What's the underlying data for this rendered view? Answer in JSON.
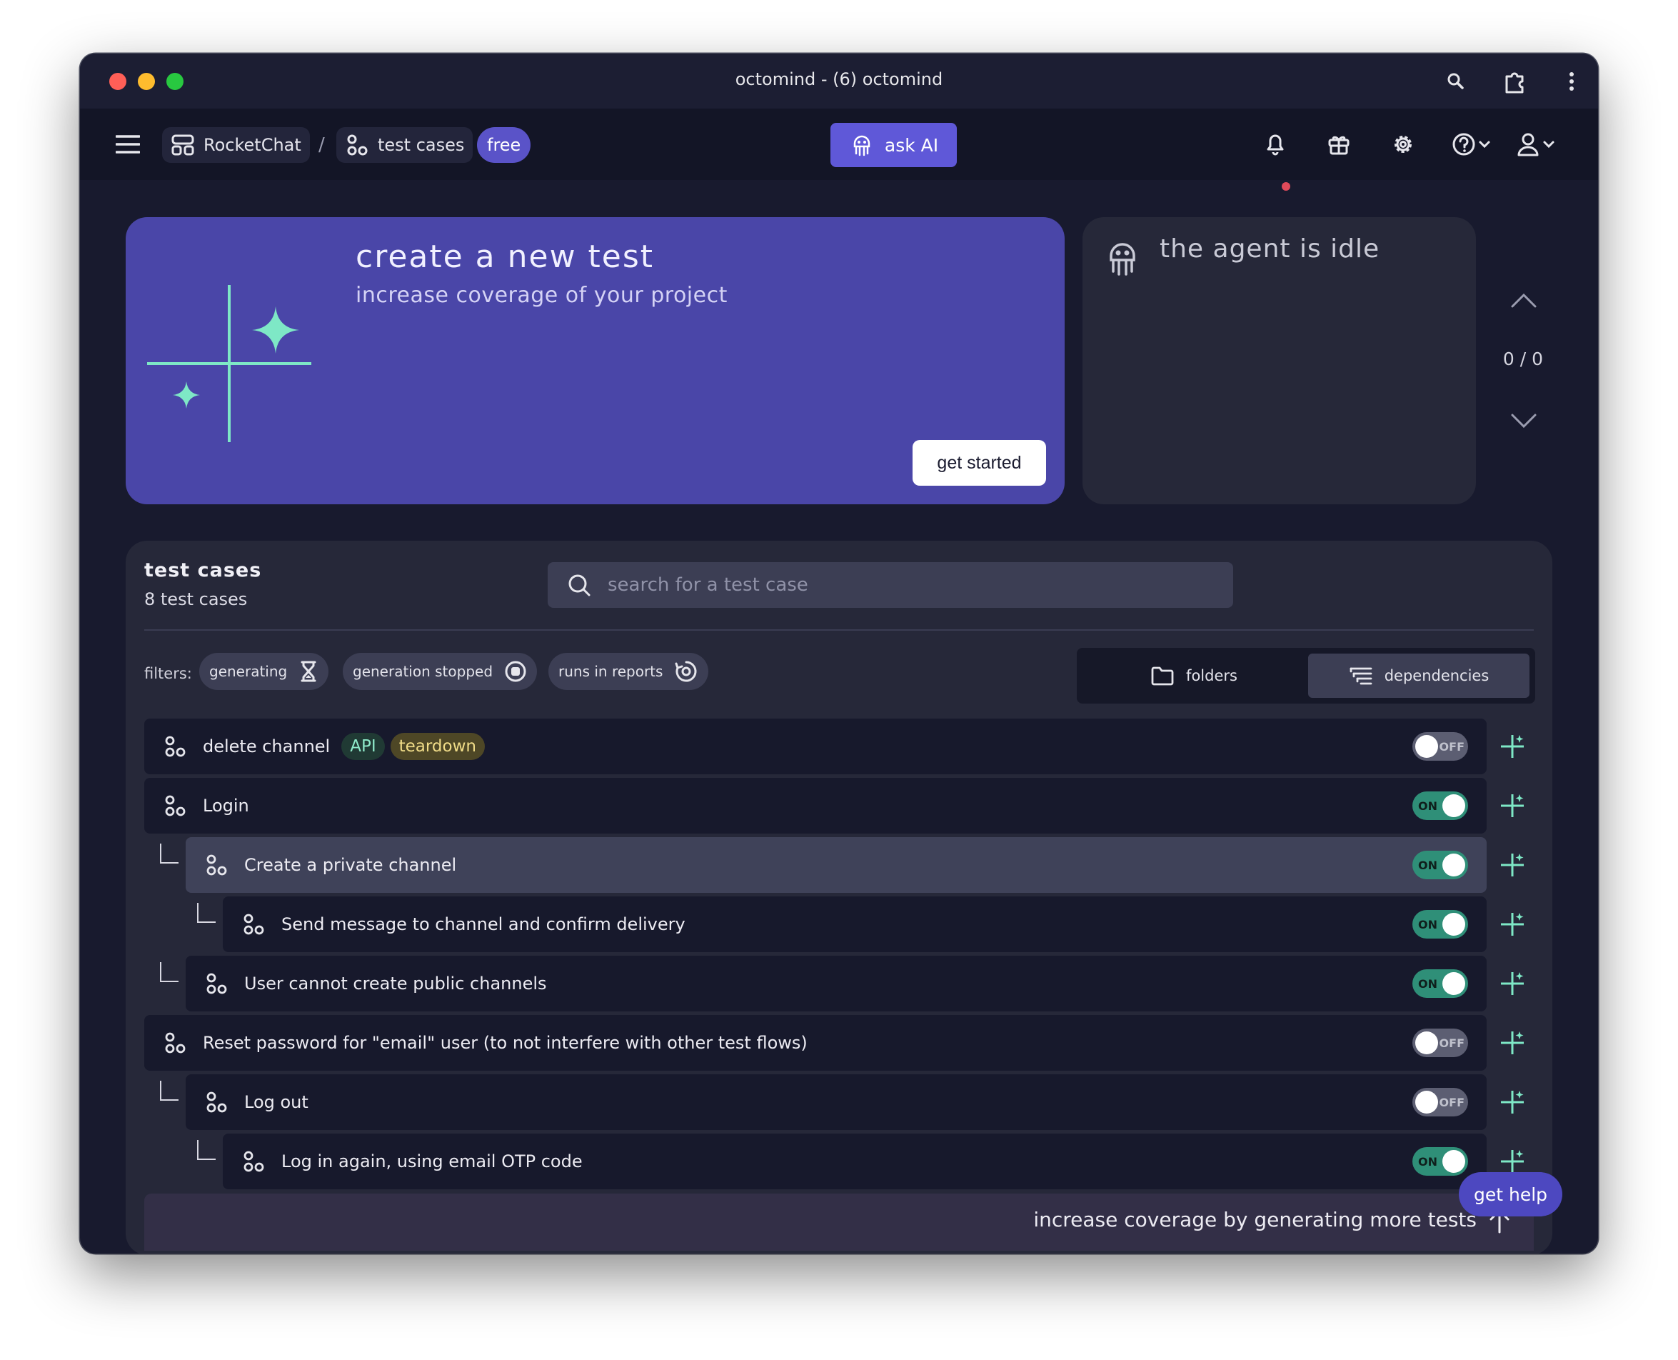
{
  "window": {
    "title": "octomind - (6) octomind"
  },
  "nav": {
    "breadcrumb_project": "RocketChat",
    "breadcrumb_separator": "/",
    "breadcrumb_page": "test cases",
    "plan_badge": "free",
    "ask_ai_label": "ask AI"
  },
  "hero": {
    "title": "create a new test",
    "subtitle": "increase coverage of your project",
    "cta_label": "get started",
    "accent_color": "#7ee8c6"
  },
  "agent": {
    "status_text": "the agent is idle",
    "pager": "0 / 0"
  },
  "test_cases": {
    "title": "test cases",
    "count_label": "8 test cases",
    "search_placeholder": "search for a test case",
    "filters_label": "filters:",
    "filters": [
      {
        "label": "generating",
        "icon": "hourglass-icon"
      },
      {
        "label": "generation stopped",
        "icon": "stop-circle-icon"
      },
      {
        "label": "runs in reports",
        "icon": "refresh-circle-icon"
      }
    ],
    "view_options": [
      {
        "label": "folders",
        "icon": "folder-icon",
        "selected": false
      },
      {
        "label": "dependencies",
        "icon": "dependencies-icon",
        "selected": true
      }
    ],
    "rows": [
      {
        "label": "delete channel",
        "tags": [
          "API",
          "teardown"
        ],
        "enabled": false,
        "toggle_text": "OFF",
        "depth": 0
      },
      {
        "label": "Login",
        "tags": [],
        "enabled": true,
        "toggle_text": "ON",
        "depth": 0
      },
      {
        "label": "Create a private channel",
        "tags": [],
        "enabled": true,
        "toggle_text": "ON",
        "depth": 1,
        "selected": true
      },
      {
        "label": "Send message to channel and confirm delivery",
        "tags": [],
        "enabled": true,
        "toggle_text": "ON",
        "depth": 2
      },
      {
        "label": "User cannot create public channels",
        "tags": [],
        "enabled": true,
        "toggle_text": "ON",
        "depth": 1
      },
      {
        "label": "Reset password for \"email\" user (to not interfere with other test flows)",
        "tags": [],
        "enabled": false,
        "toggle_text": "OFF",
        "depth": 0
      },
      {
        "label": "Log out",
        "tags": [],
        "enabled": false,
        "toggle_text": "OFF",
        "depth": 1
      },
      {
        "label": "Log in again, using email OTP code",
        "tags": [],
        "enabled": true,
        "toggle_text": "ON",
        "depth": 2
      }
    ],
    "footer_text": "increase coverage by generating more tests"
  },
  "help": {
    "label": "get help"
  },
  "colors": {
    "accent": "#5f58d8",
    "toggle_on": "#2f8f78",
    "toggle_off": "#5c5e72",
    "background": "#181a2e"
  }
}
